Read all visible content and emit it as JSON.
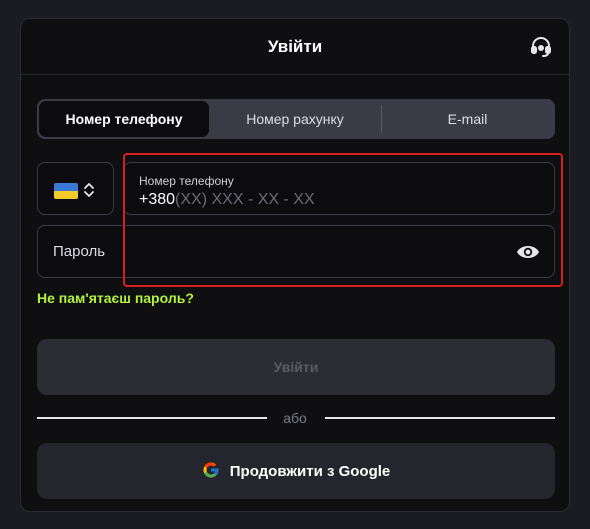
{
  "header": {
    "title": "Увійти",
    "support_icon": "headset-icon"
  },
  "tabs": [
    {
      "label": "Номер телефону",
      "active": true
    },
    {
      "label": "Номер рахунку",
      "active": false
    },
    {
      "label": "E-mail",
      "active": false
    }
  ],
  "country_selector": {
    "flag": "ukraine-flag-icon",
    "chevron": "chevron-up-down-icon"
  },
  "phone_field": {
    "label": "Номер телефону",
    "prefix": "+380",
    "placeholder": "(XX) XXX - XX - XX"
  },
  "password_field": {
    "placeholder": "Пароль",
    "toggle_icon": "eye-icon"
  },
  "forgot_password": "Не пам'ятаєш пароль?",
  "login_button": "Увійти",
  "divider_text": "або",
  "google_button": "Продовжити з Google",
  "colors": {
    "accent_link": "#b4f23c",
    "highlight_border": "#d32020",
    "background": "#0f0f12"
  }
}
